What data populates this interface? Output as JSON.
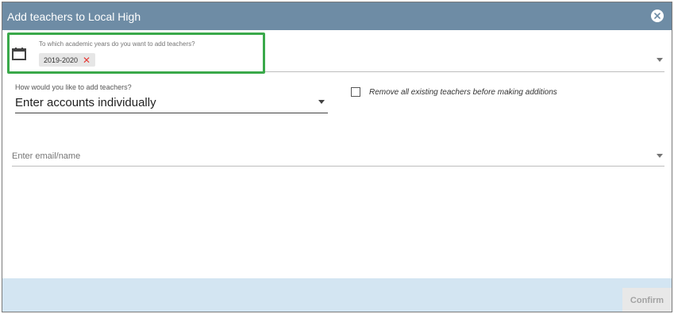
{
  "dialog": {
    "title": "Add teachers to Local High",
    "close_icon": "close-circle-icon"
  },
  "year_field": {
    "icon": "calendar-icon",
    "label": "To which academic years do you want to add teachers?",
    "chips": [
      {
        "label": "2019-2020",
        "remove_symbol": "✕"
      }
    ]
  },
  "method_field": {
    "label": "How would you like to add teachers?",
    "value": "Enter accounts individually"
  },
  "remove_option": {
    "checked": false,
    "label": "Remove all existing teachers before making additions"
  },
  "email_field": {
    "placeholder": "Enter email/name",
    "value": ""
  },
  "footer": {
    "confirm_label": "Confirm"
  },
  "colors": {
    "titlebar": "#6e8ca5",
    "footer": "#d3e5f2",
    "highlight": "#3aa94a",
    "chip_remove": "#e53935"
  }
}
